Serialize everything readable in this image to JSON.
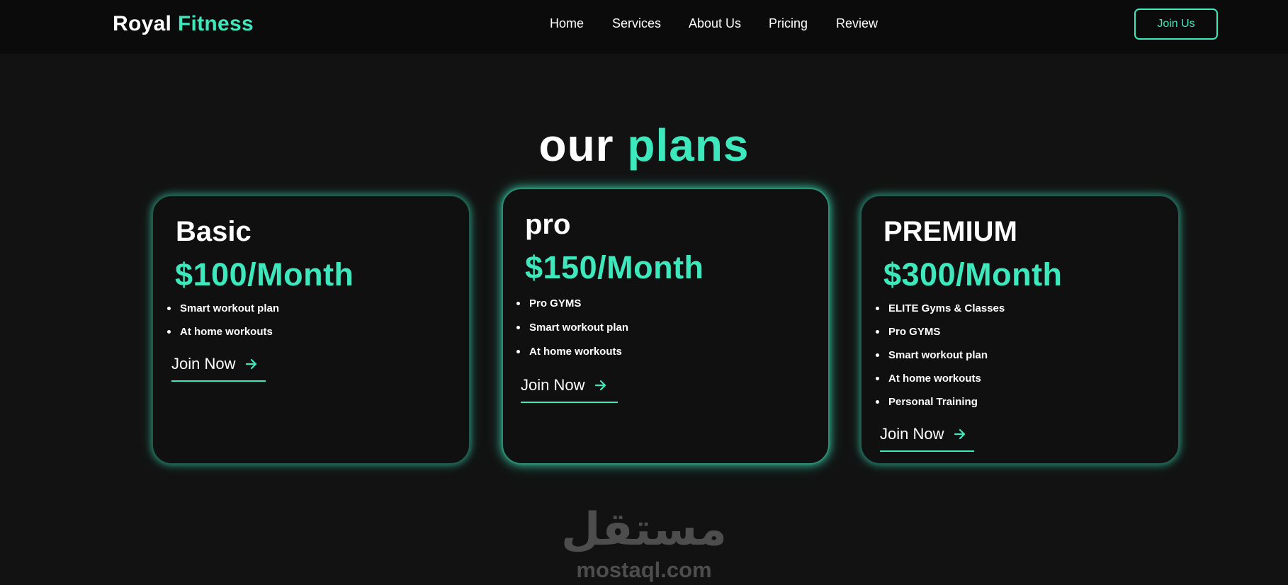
{
  "brand": {
    "part1": "Royal",
    "part2": "Fitness",
    "accent_color": "#3ee8bd"
  },
  "nav": {
    "items": [
      "Home",
      "Services",
      "About Us",
      "Pricing",
      "Review"
    ],
    "cta": "Join Us"
  },
  "section": {
    "title_part1": "our",
    "title_part2": "plans"
  },
  "plans": [
    {
      "name": "Basic",
      "price": "$100/Month",
      "features": [
        "Smart workout plan",
        "At home workouts"
      ],
      "cta": "Join Now",
      "cta_icon": "arrow-right-icon"
    },
    {
      "name": "pro",
      "price": "$150/Month",
      "features": [
        "Pro GYMS",
        "Smart workout plan",
        "At home workouts"
      ],
      "cta": "Join Now",
      "cta_icon": "arrow-right-icon"
    },
    {
      "name": "PREMIUM",
      "price": "$300/Month",
      "features": [
        "ELITE Gyms & Classes",
        "Pro GYMS",
        "Smart workout plan",
        "At home workouts",
        "Personal Training"
      ],
      "cta": "Join Now",
      "cta_icon": "arrow-right-icon"
    }
  ],
  "watermark": {
    "arabic": "مستقل",
    "latin": "mostaql.com"
  }
}
